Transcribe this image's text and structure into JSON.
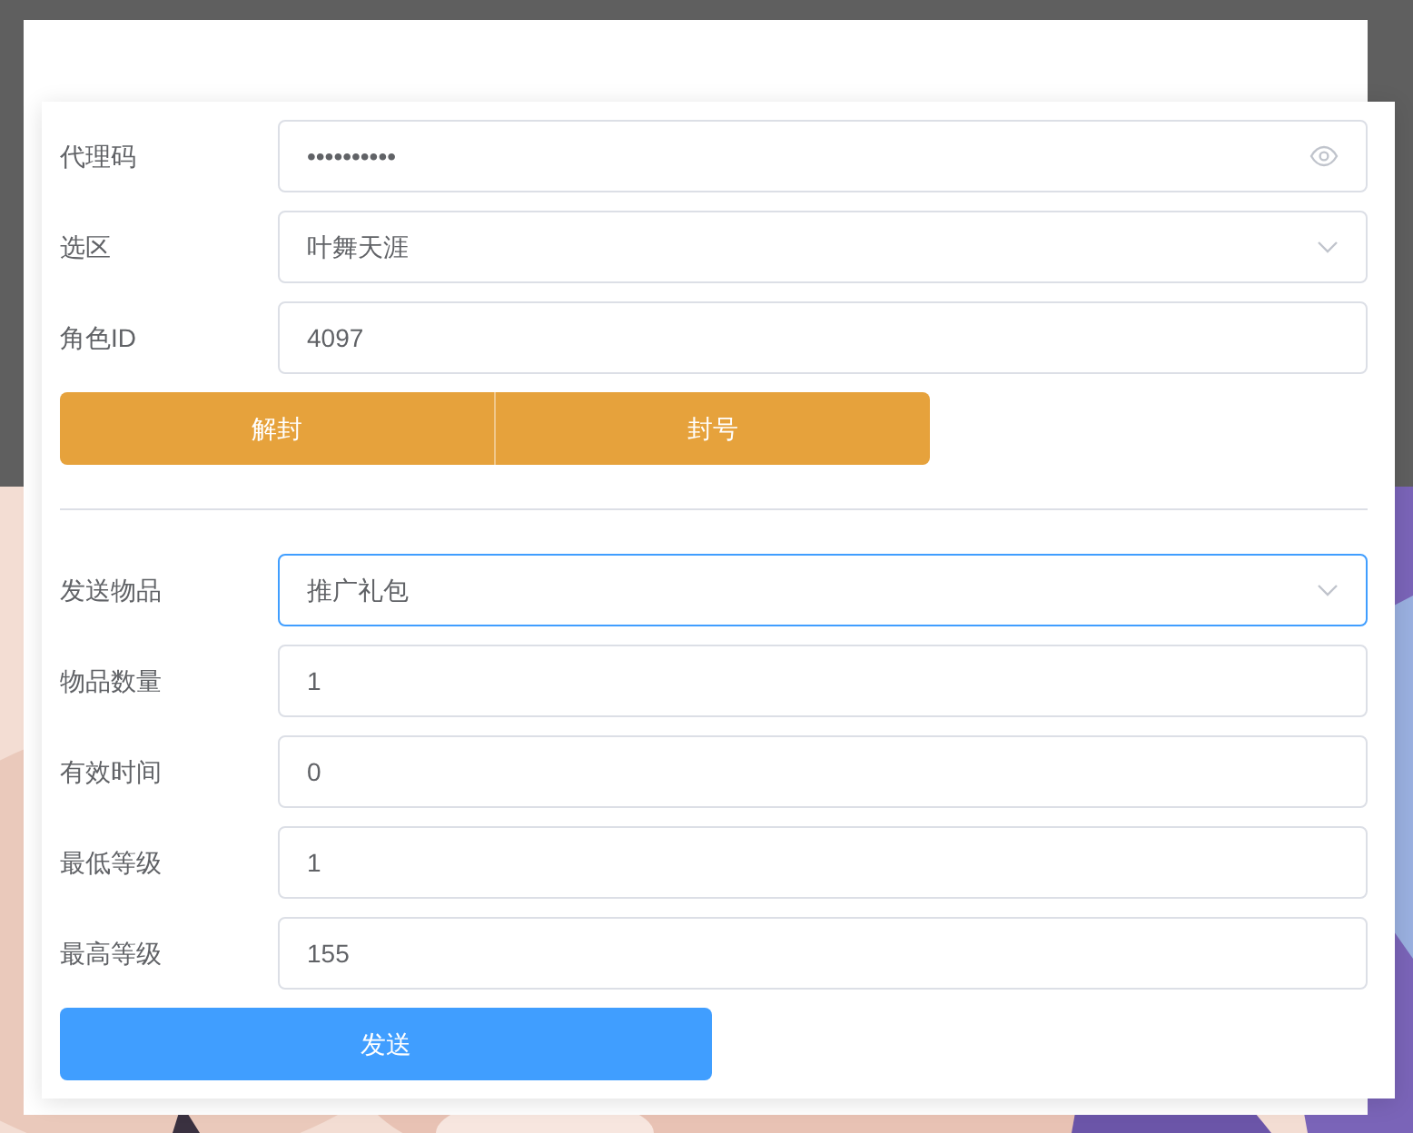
{
  "account_fields": [
    {
      "label": "代理码",
      "kind": "password",
      "value": "••••••••••",
      "focused": false
    },
    {
      "label": "选区",
      "kind": "select",
      "value": "叶舞天涯",
      "focused": false
    },
    {
      "label": "角色ID",
      "kind": "text",
      "value": "4097",
      "focused": false
    }
  ],
  "account_buttons": [
    "解封",
    "封号"
  ],
  "item_fields": [
    {
      "label": "发送物品",
      "kind": "select",
      "value": "推广礼包",
      "focused": true
    },
    {
      "label": "物品数量",
      "kind": "text",
      "value": "1",
      "focused": false
    },
    {
      "label": "有效时间",
      "kind": "text",
      "value": "0",
      "focused": false
    },
    {
      "label": "最低等级",
      "kind": "text",
      "value": "1",
      "focused": false
    },
    {
      "label": "最高等级",
      "kind": "text",
      "value": "155",
      "focused": false
    }
  ],
  "send_button": "发送"
}
